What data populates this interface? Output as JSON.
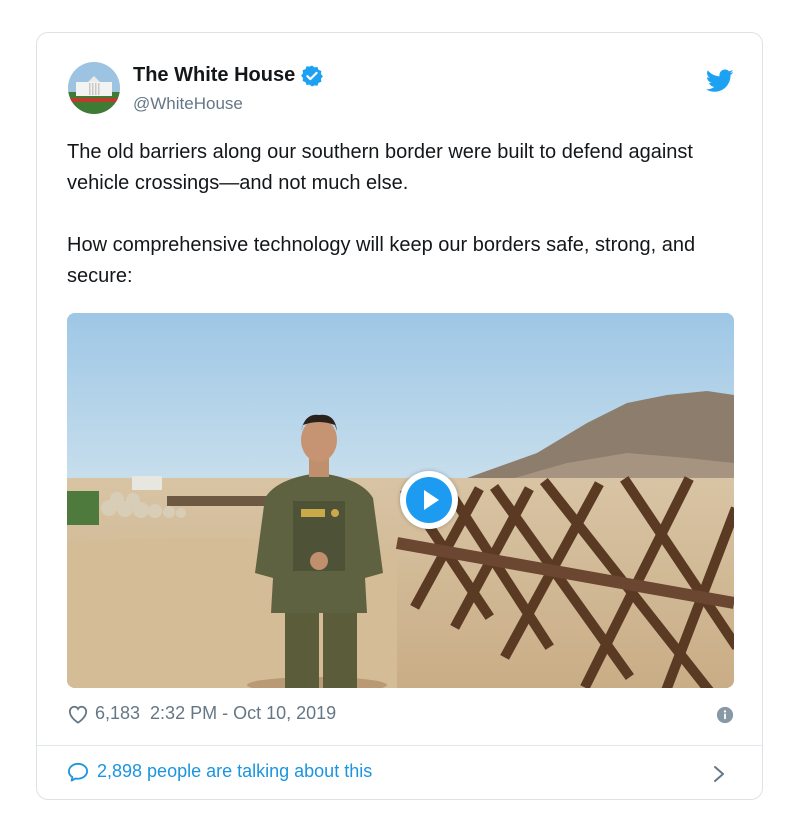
{
  "author": {
    "name": "The White House",
    "handle": "@WhiteHouse"
  },
  "tweet": {
    "paragraphs": [
      "The old barriers along our southern border were built to defend against vehicle crossings—and not much else.",
      "How comprehensive technology will keep our borders safe, strong, and secure:"
    ]
  },
  "meta": {
    "likes": "6,183",
    "timestamp": "2:32 PM - Oct 10, 2019"
  },
  "footer": {
    "talking": "2,898 people are talking about this"
  },
  "icons": {
    "verified": "verified-badge-icon",
    "brand": "twitter-bird-icon",
    "like": "heart-icon",
    "info": "info-icon",
    "reply": "speech-bubble-icon",
    "more": "chevron-right-icon",
    "play": "play-icon"
  },
  "colors": {
    "accent": "#1da1f2",
    "link": "#1b95e0",
    "text": "#14171a",
    "muted": "#657786"
  }
}
